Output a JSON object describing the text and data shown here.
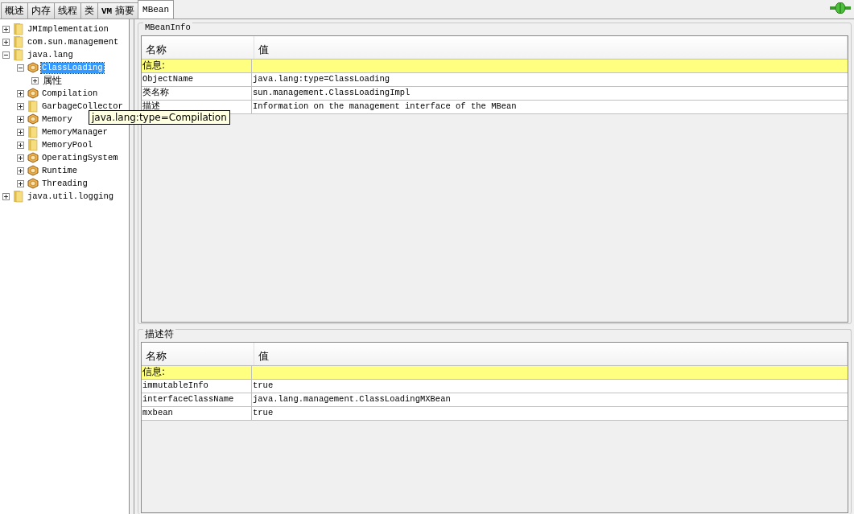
{
  "tabs": [
    {
      "label": "概述",
      "selected": false
    },
    {
      "label": "内存",
      "selected": false
    },
    {
      "label": "线程",
      "selected": false
    },
    {
      "label": "类",
      "selected": false
    },
    {
      "label": "**VM** 摘要",
      "selected": false
    },
    {
      "label": "MBean",
      "selected": true
    }
  ],
  "tree": [
    {
      "label": "JMImplementation",
      "kind": "folder",
      "expanded": false,
      "selected": false
    },
    {
      "label": "com.sun.management",
      "kind": "folder",
      "expanded": false,
      "selected": false
    },
    {
      "label": "java.lang",
      "kind": "folder",
      "expanded": true,
      "selected": false,
      "children": [
        {
          "label": "ClassLoading",
          "kind": "bean",
          "expanded": true,
          "selected": true,
          "children": [
            {
              "label": "属性",
              "kind": "plain",
              "expanded": false,
              "selected": false
            }
          ]
        },
        {
          "label": "Compilation",
          "kind": "bean",
          "expanded": false,
          "selected": false
        },
        {
          "label": "GarbageCollector",
          "kind": "folder",
          "expanded": false,
          "selected": false
        },
        {
          "label": "Memory",
          "kind": "bean",
          "expanded": false,
          "selected": false
        },
        {
          "label": "MemoryManager",
          "kind": "folder",
          "expanded": false,
          "selected": false
        },
        {
          "label": "MemoryPool",
          "kind": "folder",
          "expanded": false,
          "selected": false
        },
        {
          "label": "OperatingSystem",
          "kind": "bean",
          "expanded": false,
          "selected": false
        },
        {
          "label": "Runtime",
          "kind": "bean",
          "expanded": false,
          "selected": false
        },
        {
          "label": "Threading",
          "kind": "bean",
          "expanded": false,
          "selected": false
        }
      ]
    },
    {
      "label": "java.util.logging",
      "kind": "folder",
      "expanded": false,
      "selected": false
    }
  ],
  "tooltip": {
    "text": "java.lang:type=Compilation"
  },
  "panels": [
    {
      "title": "MBeanInfo",
      "columns": [
        "名称",
        "值"
      ],
      "rows": [
        {
          "kind": "section",
          "name": "信息:"
        },
        {
          "kind": "data",
          "name": "ObjectName",
          "value": "java.lang:type=ClassLoading"
        },
        {
          "kind": "data",
          "name": "类名称",
          "value": "sun.management.ClassLoadingImpl"
        },
        {
          "kind": "data",
          "name": "描述",
          "value": "Information on the management interface of the MBean"
        }
      ]
    },
    {
      "title": "描述符",
      "columns": [
        "名称",
        "值"
      ],
      "rows": [
        {
          "kind": "section",
          "name": "信息:"
        },
        {
          "kind": "data",
          "name": "immutableInfo",
          "value": "true"
        },
        {
          "kind": "data",
          "name": "interfaceClassName",
          "value": "java.lang.management.ClassLoadingMXBean"
        },
        {
          "kind": "data",
          "name": "mxbean",
          "value": "true"
        }
      ]
    }
  ]
}
